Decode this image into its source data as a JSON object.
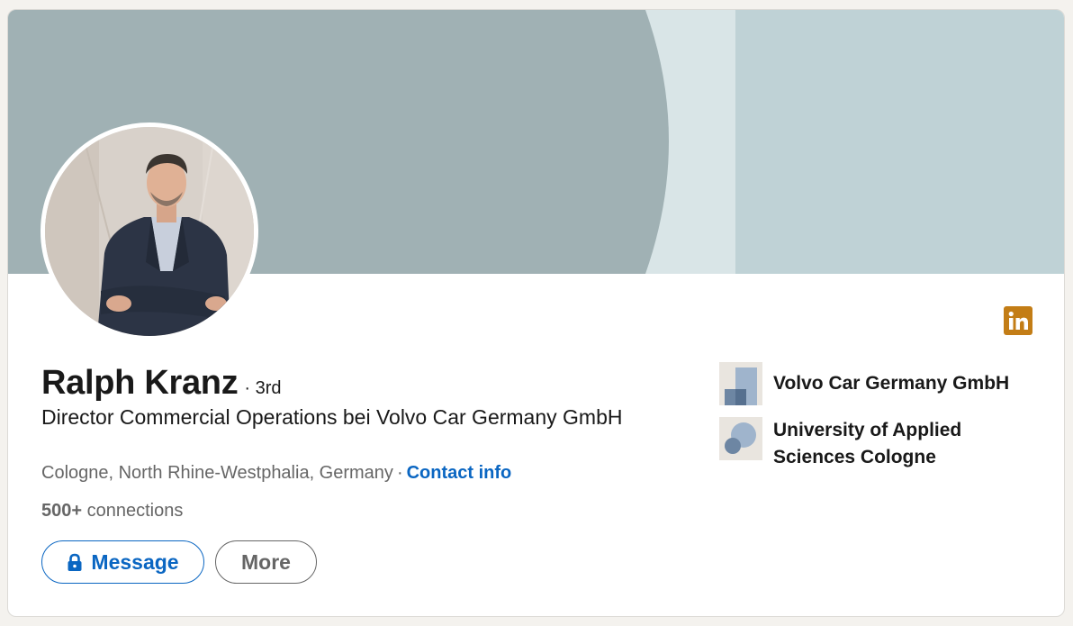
{
  "profile": {
    "name": "Ralph Kranz",
    "degree": "· 3rd",
    "headline": "Director Commercial Operations bei Volvo Car Germany GmbH",
    "location": "Cologne, North Rhine-Westphalia, Germany",
    "location_separator": "·",
    "contact_info_label": "Contact info",
    "connections_count": "500+",
    "connections_label": "connections"
  },
  "actions": {
    "message_label": "Message",
    "more_label": "More"
  },
  "organizations": [
    {
      "name": "Volvo Car Germany GmbH",
      "icon": "company-logo-icon"
    },
    {
      "name": "University of Applied Sciences Cologne",
      "icon": "school-logo-icon"
    }
  ],
  "icons": {
    "badge": "linkedin-icon",
    "message": "lock-icon"
  },
  "colors": {
    "accent": "#0a66c2",
    "badge": "#c37d16",
    "banner": "#a0b1b4",
    "banner_light": "#bfd2d6"
  }
}
